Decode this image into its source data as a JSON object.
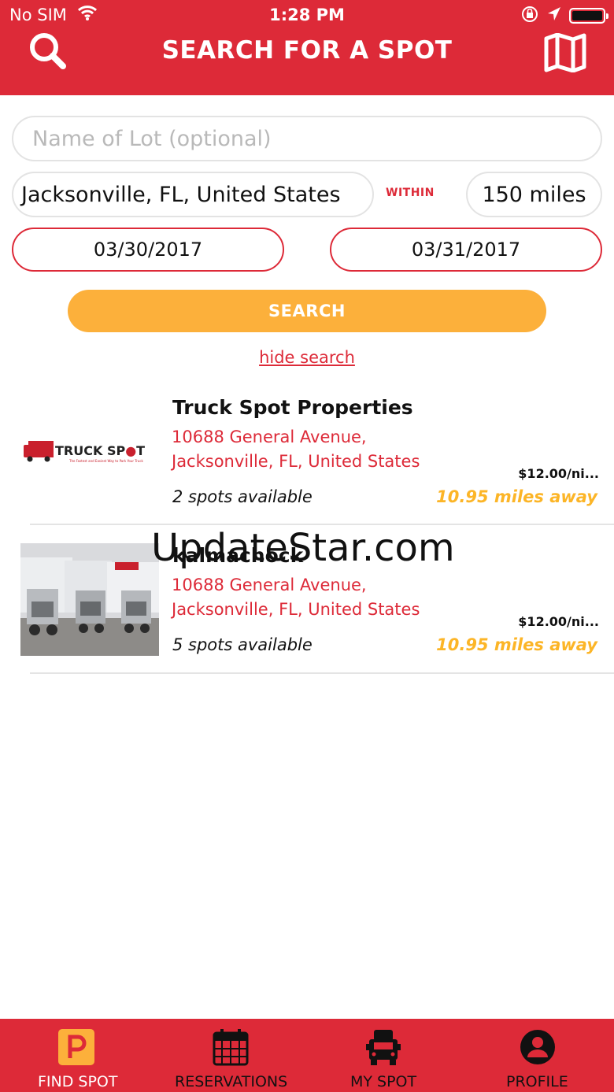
{
  "status_bar": {
    "carrier": "No SIM",
    "time": "1:28 PM"
  },
  "header": {
    "title": "SEARCH FOR A SPOT",
    "left_icon": "search-icon",
    "right_icon": "map-icon",
    "background_color": "#dd2a38"
  },
  "search_form": {
    "name_placeholder": "Name of Lot (optional)",
    "location_value": "Jacksonville, FL, United States",
    "within_label": "WITHIN",
    "radius_value": "150 miles",
    "start_date": "03/30/2017",
    "end_date": "03/31/2017",
    "search_label": "SEARCH",
    "hide_search_label": "hide search",
    "accent_color": "#fcb03b"
  },
  "results": [
    {
      "logo_text": "TRUCK SP",
      "logo_text_tail": "T",
      "logo_tagline": "The Fastest and Easiest Way to Park Your Truck",
      "name": "Truck Spot Properties",
      "address_line1": "10688 General Avenue,",
      "address_line2": "Jacksonville, FL, United States",
      "price": "$12.00/ni...",
      "spots": "2 spots available",
      "distance": "10.95 miles away"
    },
    {
      "name": "kalmachock",
      "address_line1": "10688 General Avenue,",
      "address_line2": "Jacksonville, FL, United States",
      "price": "$12.00/ni...",
      "spots": "5 spots available",
      "distance": "10.95 miles away"
    }
  ],
  "watermark": "UpdateStar.com",
  "tabs": [
    {
      "label": "FIND SPOT",
      "icon": "parking-icon",
      "active": true
    },
    {
      "label": "RESERVATIONS",
      "icon": "calendar-icon",
      "active": false
    },
    {
      "label": "MY SPOT",
      "icon": "truck-icon",
      "active": false
    },
    {
      "label": "PROFILE",
      "icon": "user-icon",
      "active": false
    }
  ]
}
